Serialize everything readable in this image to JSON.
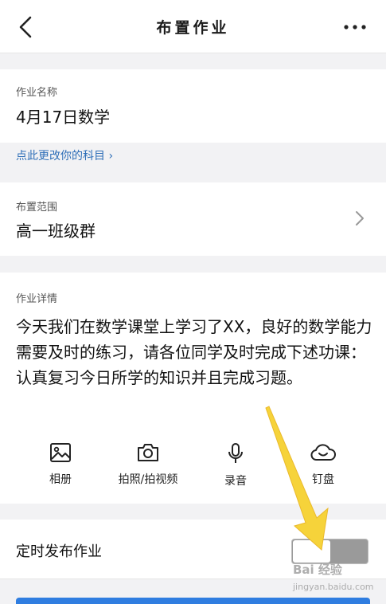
{
  "header": {
    "title": "布置作业",
    "back_icon": "chevron-left-icon",
    "more_icon": "more-dots-icon"
  },
  "name_section": {
    "label": "作业名称",
    "value": "4月17日数学",
    "change_link": "点此更改你的科目 ›"
  },
  "scope_section": {
    "label": "布置范围",
    "value": "高一班级群"
  },
  "detail_section": {
    "label": "作业详情",
    "text": "今天我们在数学课堂上学习了XX，良好的数学能力需要及时的练习，请各位同学及时完成下述功课：认真复习今日所学的知识并且完成习题。"
  },
  "tools": [
    {
      "label": "相册",
      "icon": "image-icon"
    },
    {
      "label": "拍照/拍视频",
      "icon": "camera-icon"
    },
    {
      "label": "录音",
      "icon": "microphone-icon"
    },
    {
      "label": "钉盘",
      "icon": "cloud-icon"
    }
  ],
  "timer": {
    "label": "定时发布作业",
    "enabled": false
  },
  "watermark": {
    "main": "Bai 经验",
    "sub": "jingyan.baidu.com"
  },
  "colors": {
    "link": "#2f6fb8",
    "accent": "#2f7de0",
    "annotation_arrow": "#f6d33a",
    "background": "#f2f2f4"
  }
}
